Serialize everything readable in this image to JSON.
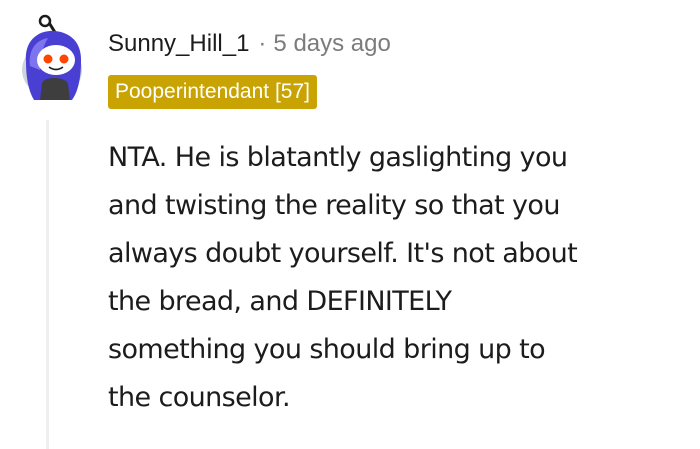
{
  "comment": {
    "username": "Sunny_Hill_1",
    "separator": "·",
    "timestamp": "5 days ago",
    "flair": "Pooperintendant [57]",
    "flair_color": "#c9a302",
    "avatar_icon": "reddit-snoo-avatar-icon",
    "body": "NTA. He is blatantly gaslighting you\nand twisting the reality so that you\nalways doubt yourself. It's not about\nthe bread, and DEFINITELY\nsomething you should bring up to\nthe counselor."
  }
}
